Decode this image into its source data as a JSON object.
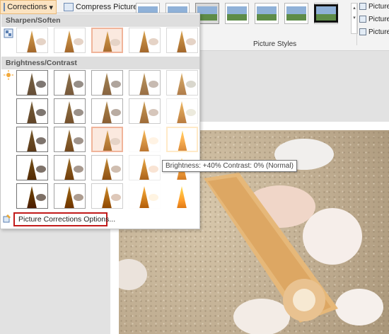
{
  "ribbon": {
    "corrections_label": "Corrections",
    "corrections_arrow": "▾",
    "compress_label": "Compress Pictures",
    "picture_styles_label": "Picture Styles",
    "right_items": [
      "Picture",
      "Picture",
      "Picture"
    ]
  },
  "dropdown": {
    "sharpen_header": "Sharpen/Soften",
    "brightness_header": "Brightness/Contrast",
    "options_link": "Picture Corrections Options..."
  },
  "tooltip": "Brightness: +40% Contrast: 0% (Normal)",
  "colors": {
    "selection_highlight": "#f0b49a",
    "options_outline": "#c21a1a",
    "corrections_active": "#fbe3c1"
  }
}
